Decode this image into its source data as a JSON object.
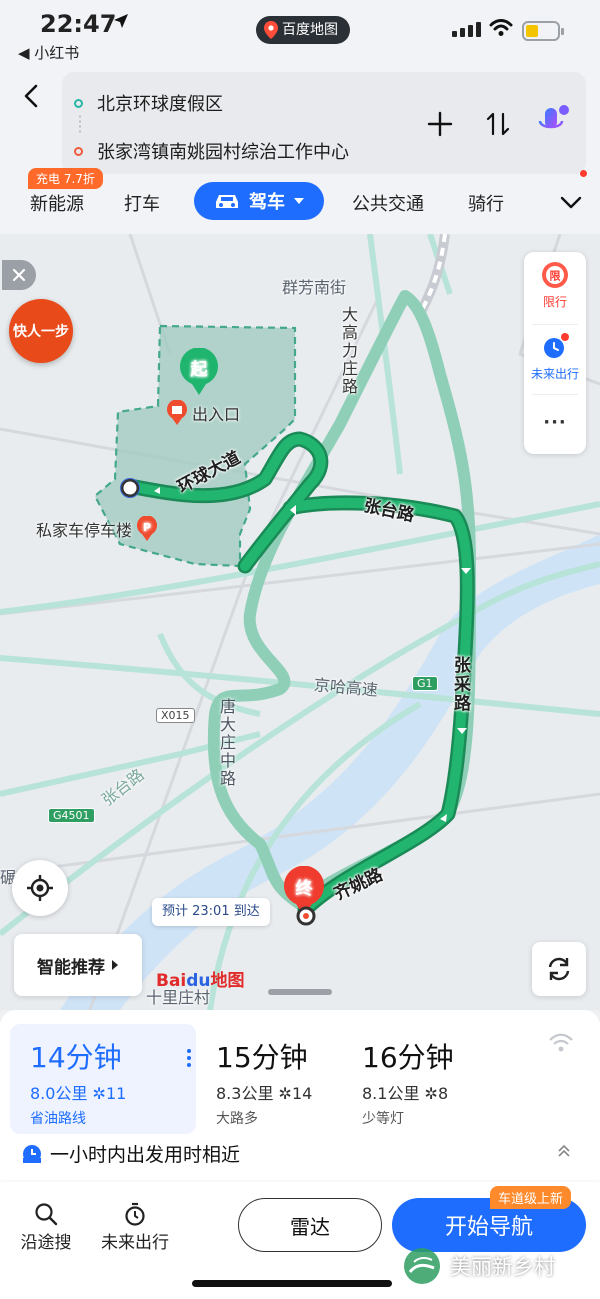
{
  "status_bar": {
    "time": "22:47",
    "back_app": "◀ 小红书",
    "center_app": "百度地图"
  },
  "route_header": {
    "origin": "北京环球度假区",
    "destination": "张家湾镇南姚园村综治工作中心",
    "icons": [
      "back-icon",
      "add-stop-icon",
      "swap-icon",
      "voice-assistant-icon"
    ]
  },
  "mode_tabs": {
    "promo": "充电 7.7折",
    "items": [
      "新能源",
      "打车",
      "驾车",
      "公共交通",
      "骑行"
    ],
    "active": "驾车"
  },
  "map": {
    "labels": {
      "street_top": "群芳南街",
      "road_dagaoli": "大高力庄路",
      "road_huanqiu": "环球大道",
      "road_zhangtai": "张台路",
      "road_zhangcai": "张采路",
      "road_jingha": "京哈高速",
      "road_tangdazhuang": "唐大庄中路",
      "road_qiyao": "齐姚路",
      "road_zhangtai_sw": "张台路",
      "village": "十里庄村",
      "edge_char": "碾"
    },
    "shields": {
      "g1": "G1",
      "x015": "X015",
      "g4501": "G4501"
    },
    "pois": {
      "start_marker": "起",
      "entrance": "出入口",
      "parking": "私家车停车楼",
      "end_marker": "终"
    },
    "fast_button": "快人一步",
    "side_panel": {
      "restriction": "限行",
      "future_trip": "未来出行",
      "more": "···"
    },
    "eta_bubble": "预计 23:01 到达",
    "smart_recommend": "智能推荐",
    "baidu_logo": {
      "bai": "Bai",
      "du": "du",
      "map": "地图"
    }
  },
  "routes": [
    {
      "time": "14分钟",
      "distance": "8.0公里",
      "lights": "11",
      "tag": "省油路线",
      "selected": true
    },
    {
      "time": "15分钟",
      "distance": "8.3公里",
      "lights": "14",
      "tag": "大路多",
      "selected": false
    },
    {
      "time": "16分钟",
      "distance": "8.1公里",
      "lights": "8",
      "tag": "少等灯",
      "selected": false
    }
  ],
  "depart_hint": "一小时内出发用时相近",
  "footer": {
    "along_search": "沿途搜",
    "future_trip": "未来出行",
    "radar": "雷达",
    "start_nav": "开始导航",
    "nav_badge": "车道级上新"
  },
  "watermark": "美丽新乡村",
  "colors": {
    "accent_blue": "#1e6dff",
    "route_green": "#1fa86b",
    "alt_route": "#8fcfb8",
    "origin_dot": "#25b6a6",
    "destination_dot": "#f05a3c",
    "end_marker_red": "#f03c2e",
    "start_marker_green": "#1fb56e"
  }
}
